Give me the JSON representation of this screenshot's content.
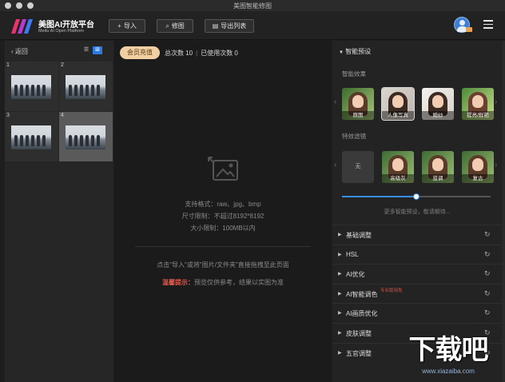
{
  "window": {
    "title": "美图智能修图"
  },
  "header": {
    "logo_title": "美图AI开放平台",
    "logo_subtitle": "Meitu AI Open Platform",
    "import_label": "导入",
    "retouch_label": "修图",
    "export_list_label": "导出列表",
    "colors": {
      "logo_pink": "#e8336d",
      "logo_blue": "#3b7cf6"
    }
  },
  "left_panel": {
    "back_label": "返回",
    "view_toggle": {
      "list_icon": "list-icon",
      "grid_icon": "grid-icon",
      "active": "grid"
    },
    "thumbnails": [
      {
        "number": "1",
        "selected": false
      },
      {
        "number": "2",
        "selected": false
      },
      {
        "number": "3",
        "selected": false
      },
      {
        "number": "4",
        "selected": true
      }
    ]
  },
  "center": {
    "member_button": "会员充值",
    "total_label": "总次数 10",
    "used_label": "已使用次数 0",
    "formats": "支持格式：raw、jpg、bmp",
    "size_limit": "尺寸限制：不超过8192*8192",
    "file_limit": "大小限制：100MB以内",
    "drag_hint": "点击\"导入\"或将\"图片/文件夹\"直接拖拽至此页面",
    "warm_tip_label": "温馨提示：",
    "warm_tip_text": "预览仅供参考，结果以实图为准"
  },
  "right_panel": {
    "smart_preset": "智能预设",
    "smart_effects_label": "智能效果",
    "effects": [
      "原图",
      "人像写真",
      "婚纱",
      "提亮/鲜艳"
    ],
    "selected_effect": "人像写真",
    "filters_label": "特效滤镜",
    "filters_none": "无",
    "filters": [
      "高级灰",
      "蓝调",
      "复古"
    ],
    "slider_value": 0.5,
    "more_tip": "更多智能预设，敬请期待...",
    "sections": [
      {
        "label": "基础调整",
        "badge": ""
      },
      {
        "label": "HSL",
        "badge": ""
      },
      {
        "label": "AI优化",
        "badge": ""
      },
      {
        "label": "AI智能调色",
        "badge": "专业版用免"
      },
      {
        "label": "AI画质优化",
        "badge": ""
      },
      {
        "label": "皮肤调整",
        "badge": ""
      },
      {
        "label": "五官调整",
        "badge": ""
      }
    ]
  },
  "watermark": {
    "text": "下载吧",
    "url": "www.xiazaiba.com"
  }
}
